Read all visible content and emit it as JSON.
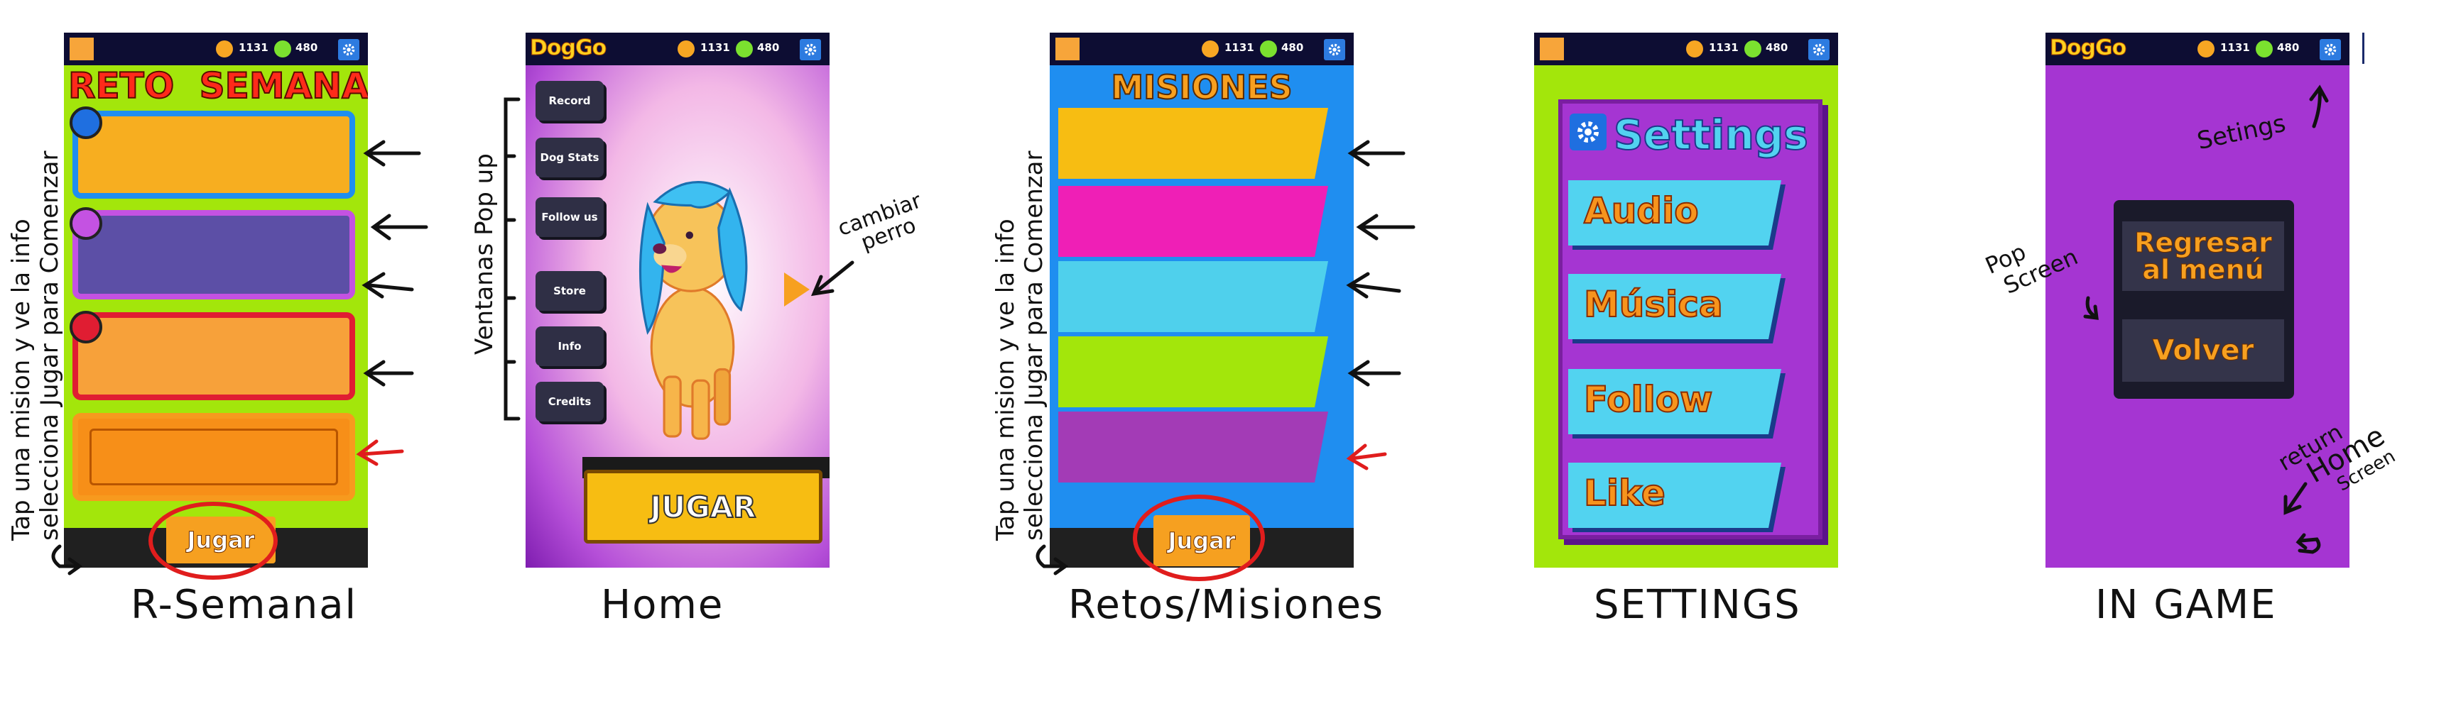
{
  "hud": {
    "coins": "1131",
    "gems": "480"
  },
  "screens": {
    "semanal": {
      "title": "RETO SEMANAL",
      "jugar": "Jugar",
      "caption": "R-Semanal",
      "note_line1": "Tap una mision y ve la info",
      "note_line2": "selecciona Jugar para Comenzar"
    },
    "home": {
      "brand": "DogGo",
      "menu": [
        "Record",
        "Dog Stats",
        "Follow us",
        "Store",
        "Info",
        "Credits"
      ],
      "play": "JUGAR",
      "popup_label": "Ventanas Pop up",
      "change_dog_line1": "cambiar",
      "change_dog_line2": "perro",
      "caption": "Home"
    },
    "misiones": {
      "title": "MISIONES",
      "jugar": "Jugar",
      "caption": "Retos/Misiones",
      "note_line1": "Tap una mision y ve la info",
      "note_line2": "selecciona Jugar para Comenzar"
    },
    "settings": {
      "title": "Settings",
      "options": [
        "Audio",
        "Música",
        "Follow",
        "Like"
      ],
      "caption": "SETTINGS"
    },
    "ingame": {
      "brand": "DogGo",
      "menu_button": "Regresar al menú",
      "back_button": "Volver",
      "note_settings": "Setings",
      "note_pop_line1": "Pop",
      "note_pop_line2": "Screen",
      "note_return_line1": "return",
      "note_return_line2": "Home",
      "note_return_line3": "Screen",
      "caption": "IN GAME"
    }
  },
  "colors": {
    "lime": "#a3e60b",
    "purple": "#a535d2",
    "blue": "#1f8ef0",
    "orange": "#f7a020",
    "yellow": "#f7bd12",
    "magenta": "#ef1fb6",
    "cyan": "#4fd0ec",
    "violet": "#a33bb6"
  }
}
